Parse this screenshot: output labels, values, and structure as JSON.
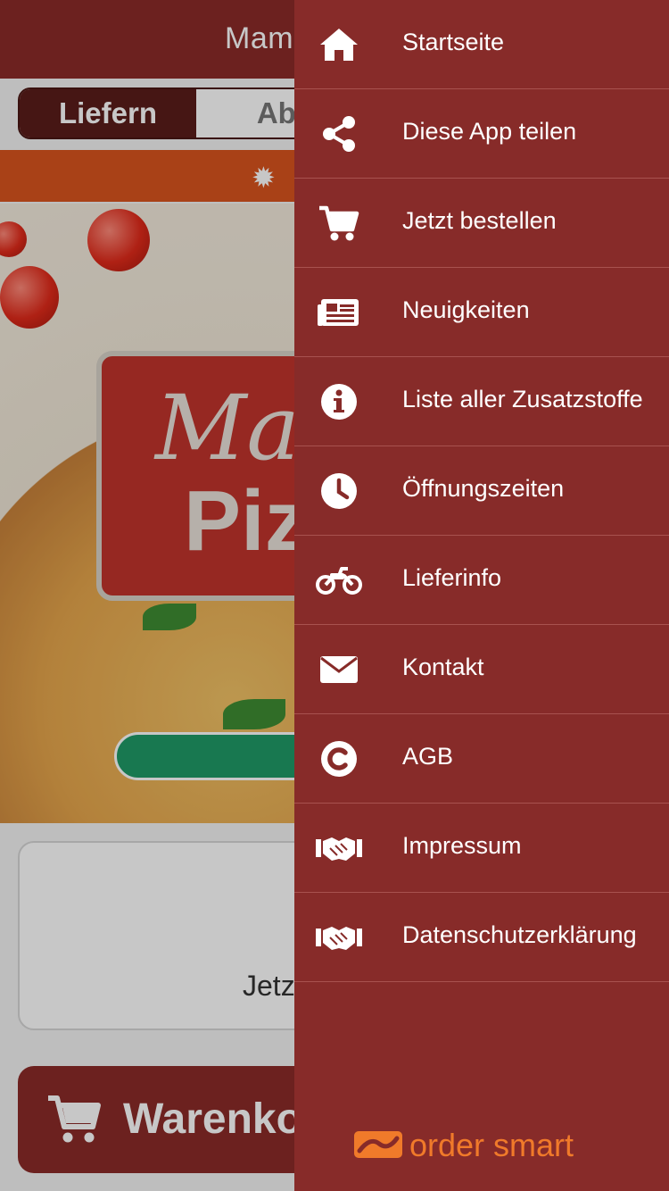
{
  "background_app": {
    "title_partial": "Mam",
    "tabs": {
      "active": "Liefern",
      "inactive_partial": "Abho"
    },
    "logo_line1_partial": "Ma",
    "logo_line2_partial": "Piz",
    "card_text_partial": "Jetz",
    "cart_label_partial": "Warenkorb"
  },
  "drawer": {
    "items": [
      {
        "label": "Startseite",
        "icon": "home-icon"
      },
      {
        "label": "Diese App teilen",
        "icon": "share-icon"
      },
      {
        "label": "Jetzt bestellen",
        "icon": "cart-icon"
      },
      {
        "label": "Neuigkeiten",
        "icon": "newspaper-icon"
      },
      {
        "label": "Liste aller Zusatzstoffe",
        "icon": "info-icon"
      },
      {
        "label": "Öffnungszeiten",
        "icon": "clock-icon"
      },
      {
        "label": "Lieferinfo",
        "icon": "motorcycle-icon"
      },
      {
        "label": "Kontakt",
        "icon": "envelope-icon"
      },
      {
        "label": "AGB",
        "icon": "copyright-icon"
      },
      {
        "label": "Impressum",
        "icon": "handshake-icon"
      },
      {
        "label": "Datenschutzerklärung",
        "icon": "handshake-icon"
      }
    ],
    "brand": "order smart"
  },
  "colors": {
    "drawer": "#872b29",
    "topbar": "#8b2b28",
    "banner": "#d9541e",
    "brand_orange": "#f07a2a",
    "green_button": "#1f9a67"
  }
}
